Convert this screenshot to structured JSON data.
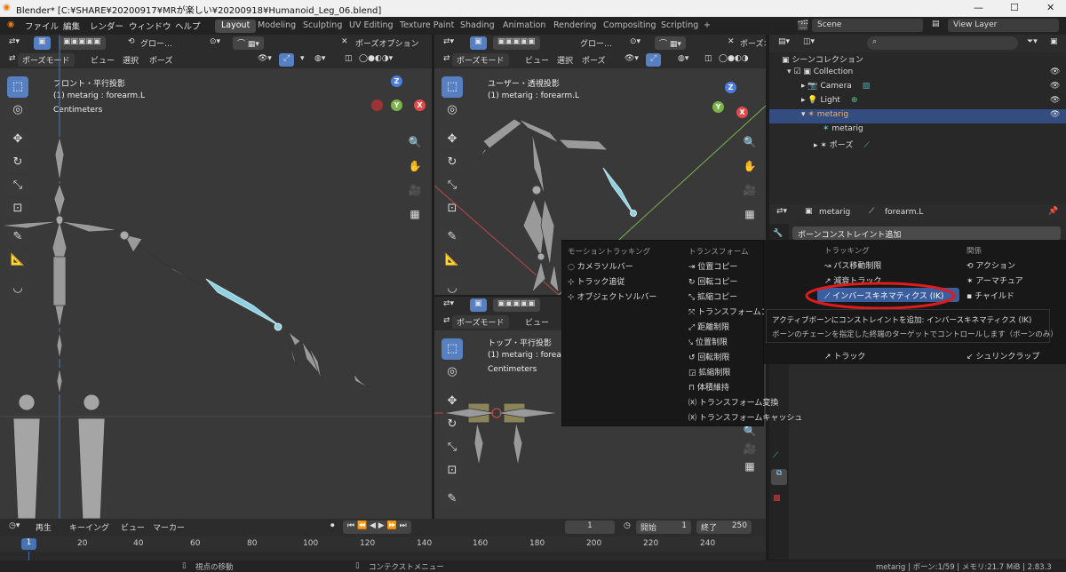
{
  "window": {
    "title": "Blender* [C:¥SHARE¥20200917¥MRが楽しい¥20200918¥Humanoid_Leg_06.blend]",
    "minimize": "—",
    "maximize": "☐",
    "close": "✕"
  },
  "menubar": {
    "items": [
      "ファイル",
      "編集",
      "レンダー",
      "ウィンドウ",
      "ヘルプ"
    ]
  },
  "workspaces": [
    "Layout",
    "Modeling",
    "Sculpting",
    "UV Editing",
    "Texture Paint",
    "Shading",
    "Animation",
    "Rendering",
    "Compositing",
    "Scripting"
  ],
  "workspace_add": "+",
  "scene": {
    "label": "Scene",
    "view_layer": "View Layer"
  },
  "viewport_header": {
    "transform": "グロー…",
    "pose_options": "ポーズオプション",
    "pose_options_short": "ポーズオ",
    "mode": "ポーズモード",
    "view": "ビュー",
    "select": "選択",
    "pose": "ポーズ"
  },
  "viewports": {
    "front": {
      "name": "フロント・平行投影",
      "object": "(1) metarig : forearm.L",
      "units": "Centimeters"
    },
    "user": {
      "name": "ユーザー・透視投影",
      "object": "(1) metarig : forearm.L"
    },
    "top": {
      "name": "トップ・平行投影",
      "object": "(1) metarig : forearm",
      "units": "Centimeters"
    }
  },
  "axes": {
    "x": "X",
    "y": "Y",
    "z": "Z"
  },
  "outliner": {
    "search_placeholder": "",
    "items": [
      "シーンコレクション",
      "Collection",
      "Camera",
      "Light",
      "metarig",
      "metarig",
      "ポーズ"
    ]
  },
  "properties": {
    "object": "metarig",
    "bone": "forearm.L",
    "add_constraint": "ボーンコンストレイント追加"
  },
  "constraint_menu": {
    "motion_tracking": {
      "header": "モーショントラッキング",
      "items": [
        "カメラソルバー",
        "トラック追従",
        "オブジェクトソルバー"
      ]
    },
    "transform": {
      "header": "トランスフォーム",
      "items": [
        "位置コピー",
        "回転コピー",
        "拡縮コピー",
        "トランスフォームコピー",
        "距離制限",
        "位置制限",
        "回転制限",
        "拡縮制限",
        "体積維持",
        "トランスフォーム変換",
        "トランスフォームキャッシュ"
      ]
    },
    "tracking": {
      "header": "トラッキング",
      "items": [
        "パス移動制限",
        "減衰トラック",
        "インバースキネマティクス (IK)",
        "トラック"
      ],
      "hidden_partial": "局所化トラック"
    },
    "relationship": {
      "header": "関係",
      "items": [
        "アクション",
        "アーマチュア",
        "チャイルド",
        "シュリンクラップ"
      ]
    }
  },
  "tooltip": {
    "line1": "アクティブボーンにコンストレイントを追加: インバースキネマティクス (IK)",
    "line2": "ボーンのチェーンを指定した終端のターゲットでコントロールします（ボーンのみ）"
  },
  "timeline": {
    "menus": [
      "再生",
      "キーイング",
      "ビュー",
      "マーカー"
    ],
    "current": "1",
    "start_label": "開始",
    "start": "1",
    "end_label": "終了",
    "end": "250",
    "ticks": [
      "1",
      "20",
      "40",
      "60",
      "80",
      "100",
      "120",
      "140",
      "160",
      "180",
      "200",
      "220",
      "240"
    ]
  },
  "status": {
    "left": "視点の移動",
    "middle": "コンテクストメニュー",
    "right": "metarig | ボーン:1/59 | メモリ:21.7 MiB | 2.83.3"
  },
  "colors": {
    "accent": "#5680c2",
    "active_bone": "#8fd1e0",
    "highlight_ring": "#e01b1b",
    "x_axis": "#e04a4a",
    "y_axis": "#7ab34a",
    "z_axis": "#4a7fe0"
  }
}
